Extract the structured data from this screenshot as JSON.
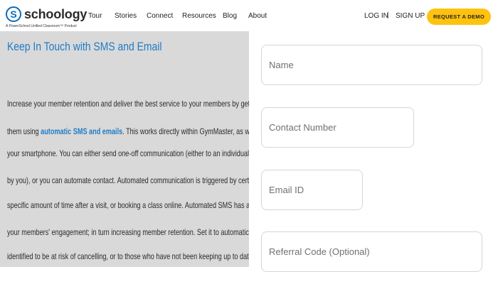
{
  "header": {
    "logo_text": "schoology",
    "logo_mark": "S",
    "logo_tagline": "A PowerSchool Unified Classroom™ Product",
    "nav": [
      "Tour",
      "Stories",
      "Connect",
      "Resources",
      "Blog",
      "About"
    ],
    "login": "LOG IN",
    "separator": "|",
    "signup": "SIGN UP",
    "request_demo": "REQUEST A DEMO",
    "accent_color": "#ffc20e"
  },
  "content": {
    "title": "Keep In Touch with SMS and Email",
    "lines": [
      "Increase your member retention and deliver the best service to your members by getting in contact with",
      "your smartphone. You can either send one-off communication (either to an individual or a group as defined",
      "by you), or you can automate contact. Automated communication is triggered by certain events, such as a",
      "specific amount of time after a visit, or booking a class online. Automated SMS has a powerful effect on",
      "your members' engagement; in turn increasing member retention. Set it to automatically contact members",
      "identified to be at risk of cancelling, or to those who have not been keeping up to date with their payments."
    ],
    "line2_before": "them using ",
    "line2_link": "automatic SMS and emails",
    "line2_after": ". This works directly within GymMaster, as well as working from",
    "link_color": "#1f7cc6"
  },
  "form": {
    "name_placeholder": "Name",
    "contact_placeholder": "Contact Number",
    "email_placeholder": "Email ID",
    "referral_placeholder": "Referral Code (Optional)"
  }
}
